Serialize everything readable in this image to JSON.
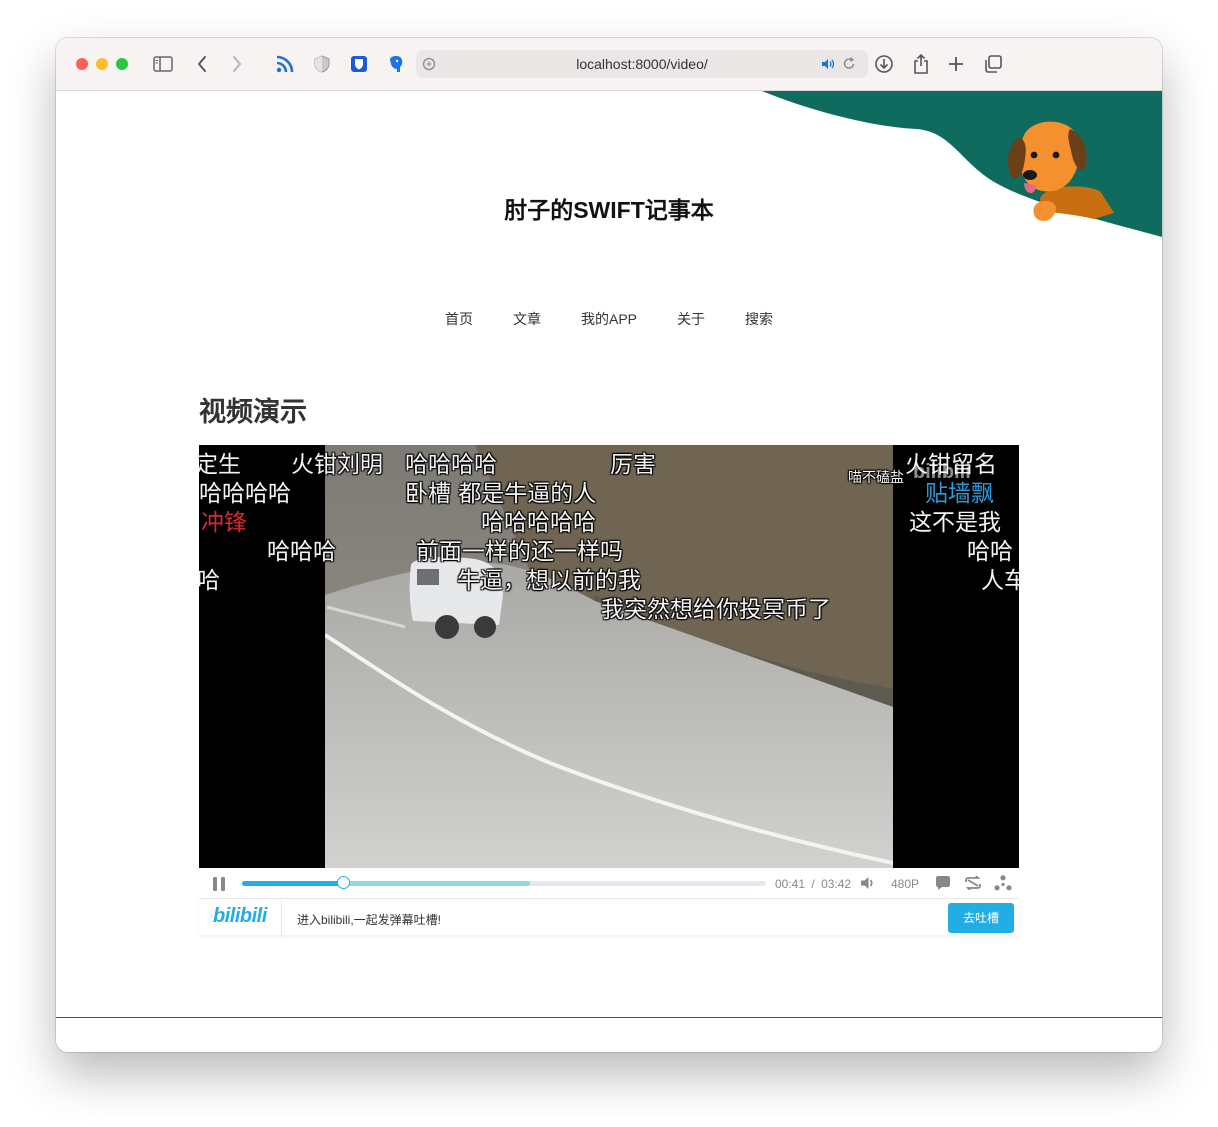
{
  "browser": {
    "url": "localhost:8000/video/"
  },
  "site": {
    "title": "肘子的SWIFT记事本",
    "nav": [
      "首页",
      "文章",
      "我的APP",
      "关于",
      "搜索"
    ]
  },
  "page": {
    "heading": "视频演示"
  },
  "player": {
    "danmaku": [
      "定生",
      "火钳刘明",
      "哈哈哈哈",
      "厉害",
      "火钳留名",
      "哈哈哈哈",
      "卧槽 都是牛逼的人",
      "喵不磕盐",
      "贴墙飘",
      "冲锋",
      "哈哈哈哈哈",
      "这不是我",
      "哈哈哈",
      "前面一样的还一样吗",
      "哈哈",
      "哈",
      "牛逼，想以前的我",
      "人车",
      "我突然想给你投冥币了"
    ],
    "watermark": "bilibili",
    "played_fraction": 0.195,
    "buffered_fraction": 0.55,
    "current_time": "00:41",
    "time_separator": "/",
    "duration": "03:42",
    "quality": "480P",
    "prompt": "进入bilibili,一起发弹幕吐槽!",
    "cta": "去吐槽",
    "logo": "bilibili",
    "accent_color": "#23ade5"
  }
}
